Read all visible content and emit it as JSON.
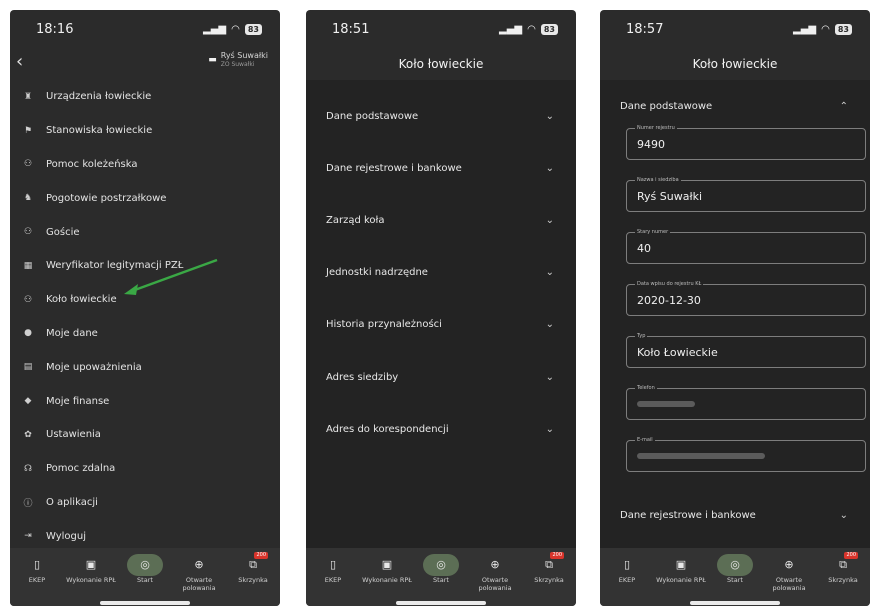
{
  "screen1": {
    "time": "18:16",
    "battery": "83",
    "club_name": "Ryś Suwałki",
    "club_sub": "ZO Suwałki",
    "menu": [
      {
        "label": "Urządzenia łowieckie",
        "icon": "tower-icon"
      },
      {
        "label": "Stanowiska łowieckie",
        "icon": "flag-icon"
      },
      {
        "label": "Pomoc koleżeńska",
        "icon": "group-icon"
      },
      {
        "label": "Pogotowie postrzałkowe",
        "icon": "dog-icon"
      },
      {
        "label": "Goście",
        "icon": "group-icon"
      },
      {
        "label": "Weryfikator legitymacji PZŁ",
        "icon": "qr-icon"
      },
      {
        "label": "Koło łowieckie",
        "icon": "group-icon"
      },
      {
        "label": "Moje dane",
        "icon": "person-icon"
      },
      {
        "label": "Moje upoważnienia",
        "icon": "document-icon"
      },
      {
        "label": "Moje finanse",
        "icon": "wallet-icon"
      },
      {
        "label": "Ustawienia",
        "icon": "gear-icon"
      },
      {
        "label": "Pomoc zdalna",
        "icon": "support-icon"
      },
      {
        "label": "O aplikacji",
        "icon": "info-icon"
      },
      {
        "label": "Wyloguj",
        "icon": "logout-icon"
      }
    ]
  },
  "screen2": {
    "time": "18:51",
    "battery": "83",
    "title": "Koło łowieckie",
    "sections": [
      "Dane podstawowe",
      "Dane rejestrowe i bankowe",
      "Zarząd koła",
      "Jednostki nadrzędne",
      "Historia przynależności",
      "Adres siedziby",
      "Adres do korespondencji"
    ]
  },
  "screen3": {
    "time": "18:57",
    "battery": "83",
    "title": "Koło łowieckie",
    "open_section": "Dane podstawowe",
    "fields": [
      {
        "label": "Numer rejestru",
        "value": "9490"
      },
      {
        "label": "Nazwa i siedziba",
        "value": "Ryś Suwałki"
      },
      {
        "label": "Stary numer",
        "value": "40"
      },
      {
        "label": "Data wpisu do rejestru KŁ",
        "value": "2020-12-30"
      },
      {
        "label": "Typ",
        "value": "Koło Łowieckie"
      },
      {
        "label": "Telefon",
        "value": ""
      },
      {
        "label": "E-mail",
        "value": ""
      }
    ],
    "next_section": "Dane rejestrowe i bankowe"
  },
  "tabbar": {
    "tabs": [
      "EKEP",
      "Wykonanie RPŁ",
      "Start",
      "Otwarte polowania",
      "Skrzynka"
    ],
    "badge": "200"
  },
  "colors": {
    "background": "#2b2b2b",
    "panel": "#232323",
    "accent_arrow": "#3aa845",
    "start_pill": "#5c6e55",
    "badge": "#d9342b"
  }
}
